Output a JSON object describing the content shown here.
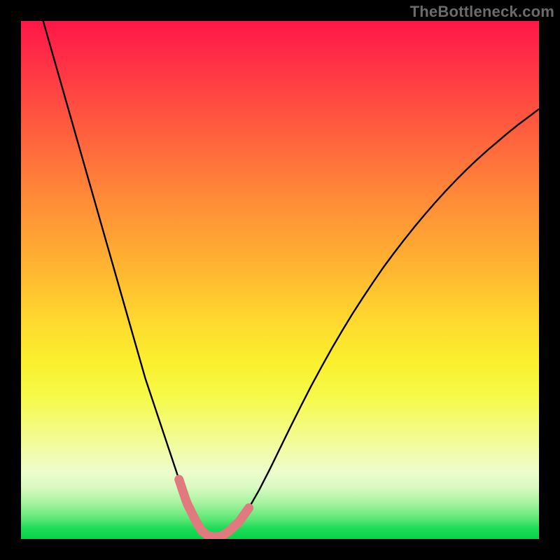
{
  "watermark": "TheBottleneck.com",
  "colors": {
    "frame": "#000000",
    "curve": "#000000",
    "highlight": "#e07a7f",
    "gradient_top": "#ff1747",
    "gradient_mid": "#ffd92f",
    "gradient_bottom": "#08d34c"
  },
  "chart_data": {
    "type": "line",
    "title": "",
    "xlabel": "",
    "ylabel": "",
    "xlim": [
      0,
      100
    ],
    "ylim": [
      0,
      100
    ],
    "x": [
      0,
      2,
      4,
      6,
      8,
      10,
      12,
      14,
      16,
      18,
      20,
      22,
      24,
      26,
      28,
      30,
      31,
      32,
      33,
      34,
      35,
      36,
      37,
      38,
      39,
      40,
      42,
      44,
      46,
      48,
      50,
      52,
      54,
      56,
      58,
      60,
      62,
      64,
      66,
      68,
      70,
      72,
      74,
      76,
      78,
      80,
      82,
      84,
      86,
      88,
      90,
      92,
      94,
      96,
      98,
      100
    ],
    "values": [
      115,
      108,
      101,
      94,
      87,
      80,
      73,
      66,
      59,
      52,
      45,
      38,
      31,
      25,
      19,
      13,
      10,
      7,
      5,
      3,
      1.5,
      0.7,
      0.4,
      0.4,
      0.7,
      1.4,
      3.2,
      6,
      9.5,
      13.4,
      17.5,
      21.6,
      25.6,
      29.5,
      33.2,
      36.8,
      40.2,
      43.5,
      46.6,
      49.6,
      52.5,
      55.2,
      57.8,
      60.3,
      62.7,
      65,
      67.2,
      69.3,
      71.3,
      73.2,
      75,
      76.7,
      78.4,
      80,
      81.5,
      83
    ],
    "comment": "values on 0–100 scale where 0=minimum at x≈37; left branch is a steep near-linear descent from off-chart (>100) at x=0; right branch is a concave-up rise approaching ~83 at x=100",
    "highlight_segments": [
      {
        "side": "left",
        "x_range": [
          30.5,
          34.5
        ]
      },
      {
        "side": "floor",
        "x_range": [
          34.5,
          40.5
        ]
      },
      {
        "side": "right",
        "x_range": [
          40.5,
          44.0
        ]
      }
    ],
    "grid": false,
    "legend": false
  }
}
